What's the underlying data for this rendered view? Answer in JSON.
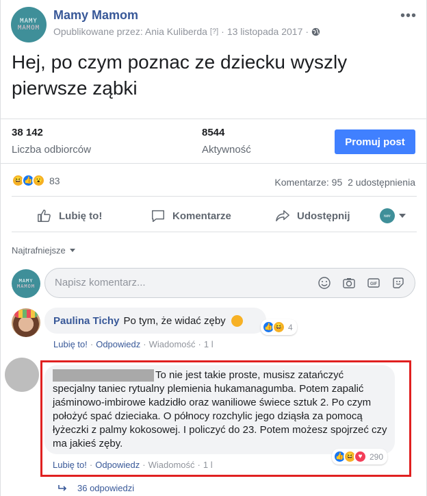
{
  "page": {
    "name": "Mamy Mamom",
    "avatar_text": [
      "MAMY",
      "MAMOM"
    ],
    "published_by": "Opublikowane przez: Ania Kuliberda",
    "question": "[?]",
    "date": "13 listopada 2017",
    "menu_icon": "more-dots-icon",
    "privacy_icon": "globe-icon"
  },
  "post": {
    "text": "Hej, po czym poznac ze dziecku wyszly pierwsze ząbki"
  },
  "stats": {
    "reach_value": "38 142",
    "reach_label": "Liczba odbiorców",
    "engagement_value": "8544",
    "engagement_label": "Aktywność",
    "promote_label": "Promuj post"
  },
  "reactions": {
    "count": "83",
    "comments": "Komentarze: 95",
    "shares": "2 udostępnienia"
  },
  "actions": {
    "like": "Lubię to!",
    "comment": "Komentarze",
    "share": "Udostępnij"
  },
  "comments": {
    "sort_label": "Najtrafniejsze",
    "input_placeholder": "Napisz komentarz...",
    "items": [
      {
        "author": "Paulina Tichy",
        "text": "Po tym, że widać zęby",
        "reaction_count": "4",
        "like": "Lubię to!",
        "reply": "Odpowiedz",
        "message": "Wiadomość",
        "time": "1 l"
      },
      {
        "text": "To nie jest takie proste, musisz zatańczyć specjalny taniec rytualny plemienia hukamanagumba. Potem zapalić jaśminowo-imbirowe kadzidło oraz waniliowe świece sztuk 2. Po czym położyć spać dzieciaka. O północy rozchylic jego dziąsła za pomocą łyżeczki z palmy kokosowej. I policzyć do 23. Potem możesz spojrzeć czy ma jakieś zęby.",
        "reaction_count": "290",
        "like": "Lubię to!",
        "reply": "Odpowiedz",
        "message": "Wiadomość",
        "time": "1 l",
        "replies": "36 odpowiedzi"
      }
    ]
  },
  "colors": {
    "link": "#385898",
    "accent": "#4080ff",
    "highlight": "#e02020"
  }
}
